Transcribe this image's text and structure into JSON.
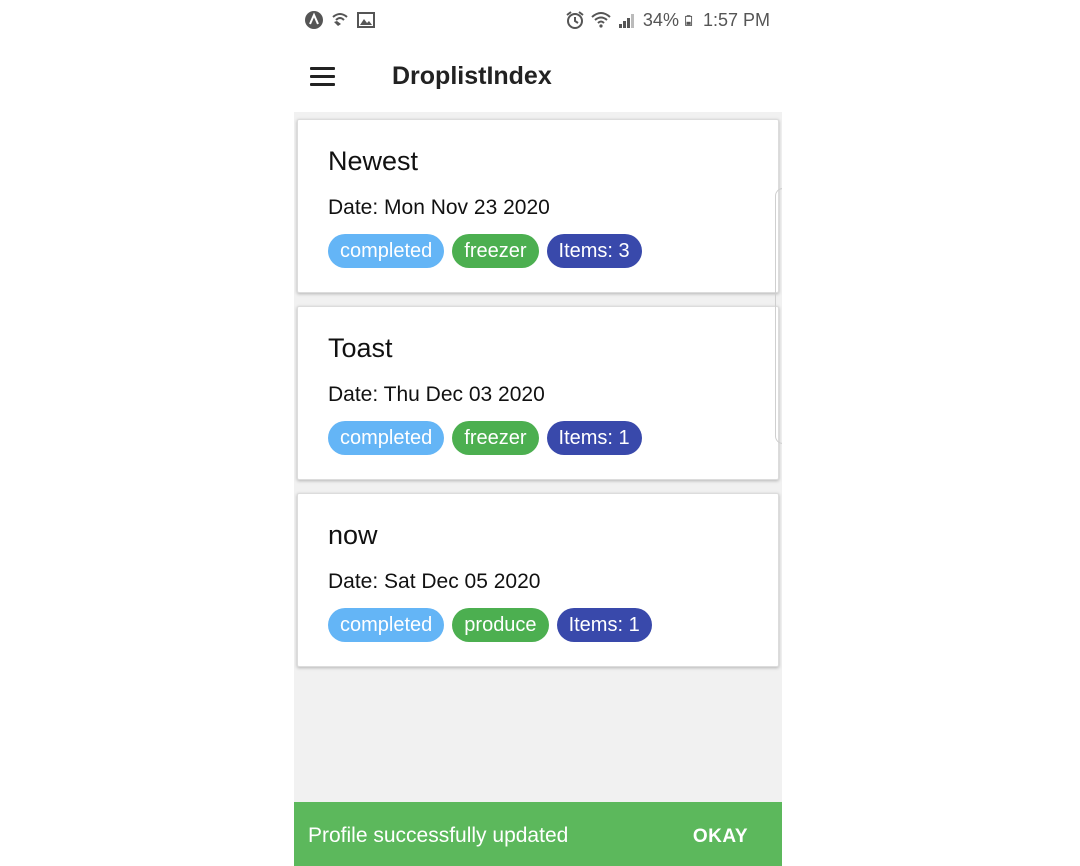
{
  "status_bar": {
    "battery": "34%",
    "time": "1:57 PM",
    "icons_left": [
      "app-a-icon",
      "wifi-call-icon",
      "image-icon"
    ],
    "icons_right": [
      "alarm-icon",
      "wifi-icon",
      "signal-icon",
      "battery-icon"
    ]
  },
  "app_bar": {
    "title": "DroplistIndex",
    "menu_icon": "hamburger-menu-icon"
  },
  "droplists": [
    {
      "title": "Newest",
      "date": "Date: Mon Nov 23 2020",
      "status": "completed",
      "category": "freezer",
      "items": "Items: 3"
    },
    {
      "title": "Toast",
      "date": "Date: Thu Dec 03 2020",
      "status": "completed",
      "category": "freezer",
      "items": "Items: 1"
    },
    {
      "title": "now",
      "date": "Date: Sat Dec 05 2020",
      "status": "completed",
      "category": "produce",
      "items": "Items: 1"
    }
  ],
  "snackbar": {
    "message": "Profile successfully updated",
    "action": "OKAY"
  },
  "colors": {
    "status_chip": "#64b5f6",
    "category_chip": "#4caf50",
    "count_chip": "#3949ab",
    "snackbar": "#5cb85c",
    "list_background": "#f1f1f1"
  }
}
